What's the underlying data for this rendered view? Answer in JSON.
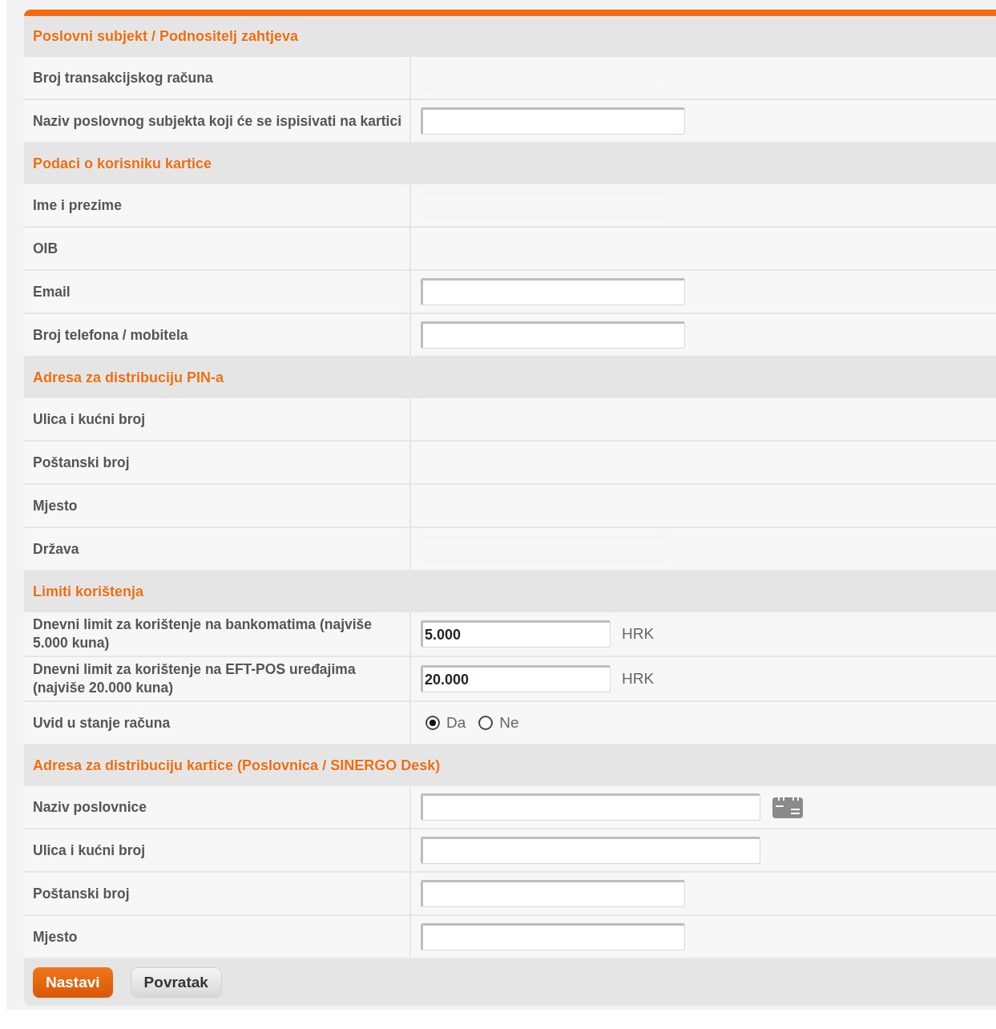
{
  "sections": [
    {
      "title": "Poslovni subjekt / Podnositelj zahtjeva",
      "rows": [
        {
          "label": "Broj transakcijskog računa",
          "kind": "readonly"
        },
        {
          "label": "Naziv poslovnog subjekta koji će se ispisivati na kartici",
          "kind": "text"
        }
      ]
    },
    {
      "title": "Podaci o korisniku kartice",
      "rows": [
        {
          "label": "Ime i prezime",
          "kind": "readonly"
        },
        {
          "label": "OIB",
          "kind": "readonly"
        },
        {
          "label": "Email",
          "kind": "text"
        },
        {
          "label": "Broj telefona / mobitela",
          "kind": "text"
        }
      ]
    },
    {
      "title": "Adresa za distribuciju PIN-a",
      "rows": [
        {
          "label": "Ulica i kućni broj",
          "kind": "empty"
        },
        {
          "label": "Poštanski broj",
          "kind": "readonly"
        },
        {
          "label": "Mjesto",
          "kind": "readonly"
        },
        {
          "label": "Država",
          "kind": "readonly"
        }
      ]
    },
    {
      "title": "Limiti korištenja",
      "rows": [
        {
          "label": "Dnevni limit za korištenje na bankomatima (najviše 5.000 kuna)",
          "kind": "amount",
          "value": "5.000",
          "unit": "HRK"
        },
        {
          "label": "Dnevni limit za korištenje na EFT-POS uređajima (najviše 20.000 kuna)",
          "kind": "amount",
          "value": "20.000",
          "unit": "HRK"
        },
        {
          "label": "Uvid u stanje računa",
          "kind": "radio",
          "options": [
            {
              "label": "Da",
              "selected": true
            },
            {
              "label": "Ne",
              "selected": false
            }
          ]
        }
      ]
    },
    {
      "title": "Adresa za distribuciju kartice (Poslovnica / SINERGO Desk)",
      "rows": [
        {
          "label": "Naziv poslovnice",
          "kind": "lookup"
        },
        {
          "label": "Ulica i kućni broj",
          "kind": "wide-text"
        },
        {
          "label": "Poštanski broj",
          "kind": "text"
        },
        {
          "label": "Mjesto",
          "kind": "text"
        }
      ]
    }
  ],
  "buttons": [
    {
      "label": "Nastavi",
      "kind": "primary"
    },
    {
      "label": "Povratak",
      "kind": "secondary"
    }
  ]
}
